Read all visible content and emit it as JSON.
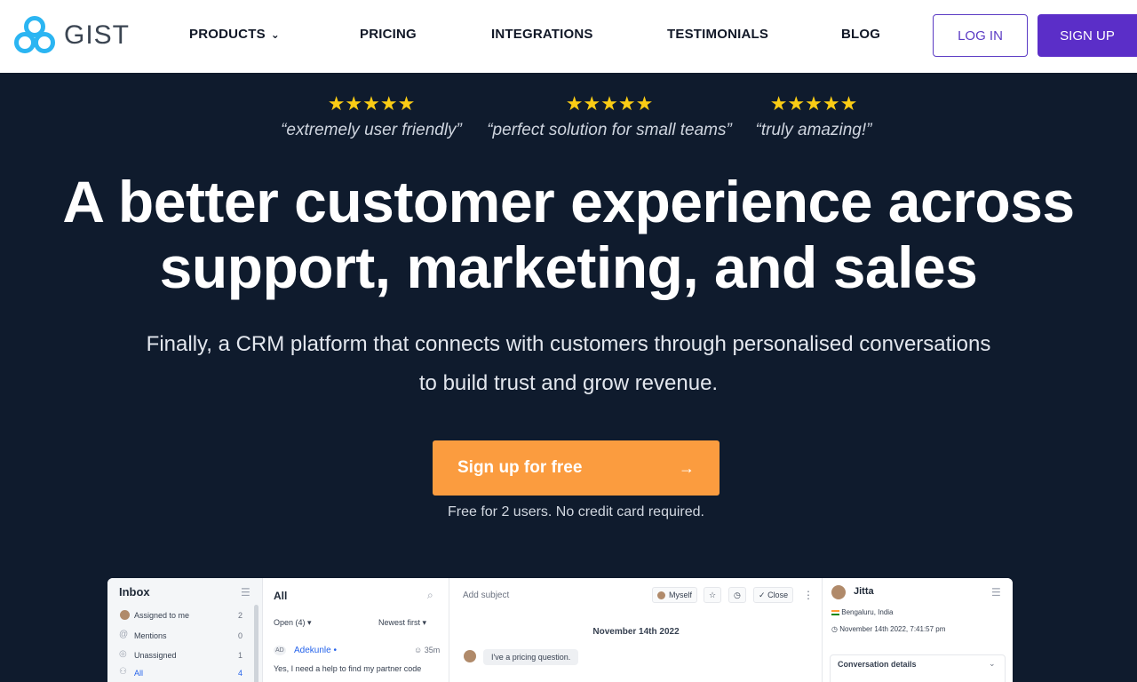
{
  "nav": {
    "logo_text": "GIST",
    "items": [
      "PRODUCTS",
      "PRICING",
      "INTEGRATIONS",
      "TESTIMONIALS",
      "BLOG"
    ],
    "login": "LOG IN",
    "signup": "SIGN UP",
    "products_chevron": "⌄"
  },
  "hero": {
    "reviews": [
      {
        "stars": "★★★★★",
        "quote": "“extremely user friendly”"
      },
      {
        "stars": "★★★★★",
        "quote": "“perfect solution for small teams”"
      },
      {
        "stars": "★★★★★",
        "quote": "“truly amazing!”"
      }
    ],
    "headline_line1": "A better customer experience across",
    "headline_line2": "support, marketing, and sales",
    "subline_line1": "Finally, a CRM platform that connects with customers through personalised conversations",
    "subline_line2": "to build trust and grow revenue.",
    "cta_label": "Sign up for free",
    "cta_arrow": "→",
    "note": "Free for 2 users. No credit card required."
  },
  "app": {
    "inbox_title": "Inbox",
    "inbox_items": [
      {
        "label": "Assigned to me",
        "count": "2"
      },
      {
        "label": "Mentions",
        "count": "0"
      },
      {
        "label": "Unassigned",
        "count": "1"
      },
      {
        "label": "All",
        "count": "4"
      }
    ],
    "list_title": "All",
    "filter_open": "Open (4)",
    "filter_sort": "Newest first",
    "conv_initials": "AD",
    "conv_name": "Adekunle",
    "conv_time": "35m",
    "conv_preview": "Yes, I need a help to find my partner code",
    "subject_placeholder": "Add subject",
    "assignee": "Myself",
    "close_label": "Close",
    "date_separator": "November 14th 2022",
    "message": "I've a pricing question.",
    "contact_name": "Jitta",
    "contact_location": "Bengaluru, India",
    "contact_time": "November 14th 2022, 7:41:57 pm",
    "details_title": "Conversation details"
  },
  "colors": {
    "brand_purple": "#5b2ec8",
    "cta_orange": "#fb9c3f",
    "hero_bg": "#0f1b2d",
    "star_yellow": "#facc15",
    "logo_blue": "#2bb5f2"
  }
}
